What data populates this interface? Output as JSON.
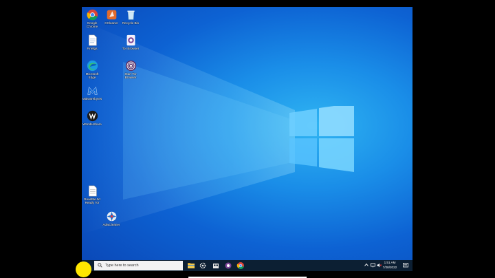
{
  "desktop": {
    "icons": [
      {
        "label": "Google Chrome",
        "icon": "chrome-icon"
      },
      {
        "label": "CCleaner",
        "icon": "ccleaner-icon"
      },
      {
        "label": "Recycle Bin",
        "icon": "recycle-bin-icon"
      },
      {
        "label": "Firefigs",
        "icon": "document-icon"
      },
      {
        "label": "Tor Browser",
        "icon": "tor-browser-icon"
      },
      {
        "label": "Microsoft Edge",
        "icon": "edge-icon"
      },
      {
        "label": "Start Tor Browser",
        "icon": "tor-start-icon"
      },
      {
        "label": "Malwarebytes",
        "icon": "malwarebytes-icon"
      },
      {
        "label": "Wondershare",
        "icon": "wondershare-icon"
      },
      {
        "label": "ReadMe.txt Ready Tor",
        "icon": "text-file-icon"
      },
      {
        "label": "AdwCleaner",
        "icon": "adwcleaner-icon"
      }
    ]
  },
  "taskbar": {
    "search_placeholder": "Type here to search",
    "apps": [
      "file-explorer-icon",
      "settings-icon",
      "store-icon",
      "tor-browser-icon",
      "chrome-icon"
    ],
    "time": "1:51 AM",
    "date": "7/28/2022"
  },
  "colors": {
    "desktop_blue": "#0d62d3",
    "taskbar": "#0c1f33",
    "highlight": "#ffe600"
  }
}
